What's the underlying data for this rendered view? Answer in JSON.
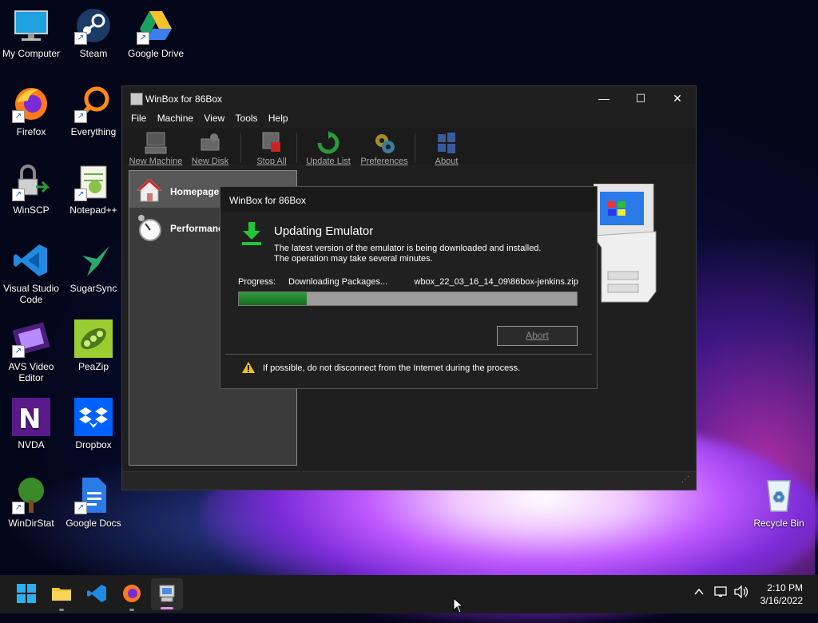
{
  "desktop": {
    "icons": [
      {
        "label": "My Computer",
        "icon": "monitor-icon"
      },
      {
        "label": "Steam",
        "icon": "steam-icon"
      },
      {
        "label": "Google Drive",
        "icon": "google-drive-icon"
      },
      {
        "label": "Firefox",
        "icon": "firefox-icon"
      },
      {
        "label": "Everything",
        "icon": "magnifier-icon"
      },
      {
        "label": "WinSCP",
        "icon": "winscp-icon"
      },
      {
        "label": "Notepad++",
        "icon": "notepad-plus-plus-icon"
      },
      {
        "label": "Visual Studio Code",
        "icon": "vscode-icon"
      },
      {
        "label": "SugarSync",
        "icon": "hummingbird-icon"
      },
      {
        "label": "AVS Video Editor",
        "icon": "film-icon"
      },
      {
        "label": "PeaZip",
        "icon": "peazip-icon"
      },
      {
        "label": "NVDA",
        "icon": "nvda-icon"
      },
      {
        "label": "Dropbox",
        "icon": "dropbox-icon"
      },
      {
        "label": "WinDirStat",
        "icon": "tree-icon"
      },
      {
        "label": "Google Docs",
        "icon": "google-docs-icon"
      },
      {
        "label": "Recycle Bin",
        "icon": "recycle-bin-icon"
      }
    ]
  },
  "window": {
    "title": "WinBox for 86Box",
    "controls": {
      "minimize": "—",
      "maximize": "☐",
      "close": "✕"
    },
    "menu": [
      "File",
      "Machine",
      "View",
      "Tools",
      "Help"
    ],
    "toolbar": [
      "New Machine",
      "New Disk",
      "Stop All",
      "Update List",
      "Preferences",
      "About"
    ],
    "sidebar": [
      "Homepage",
      "Performance"
    ]
  },
  "dialog": {
    "title": "WinBox for 86Box",
    "heading": "Updating Emulator",
    "desc_line1": "The latest version of the emulator is being downloaded and installed.",
    "desc_line2": "The operation may take several minutes.",
    "progress_label": "Progress:",
    "progress_status": "Downloading Packages...",
    "progress_file": "wbox_22_03_16_14_09\\86box-jenkins.zip",
    "progress_fraction": 0.2,
    "abort": "Abort",
    "warning": "If possible, do not disconnect from the Internet during the process."
  },
  "taskbar": {
    "time": "2:10 PM",
    "date": "3/16/2022"
  },
  "colors": {
    "progress": "#2e9a3e",
    "accent": "#1a5fd0"
  }
}
